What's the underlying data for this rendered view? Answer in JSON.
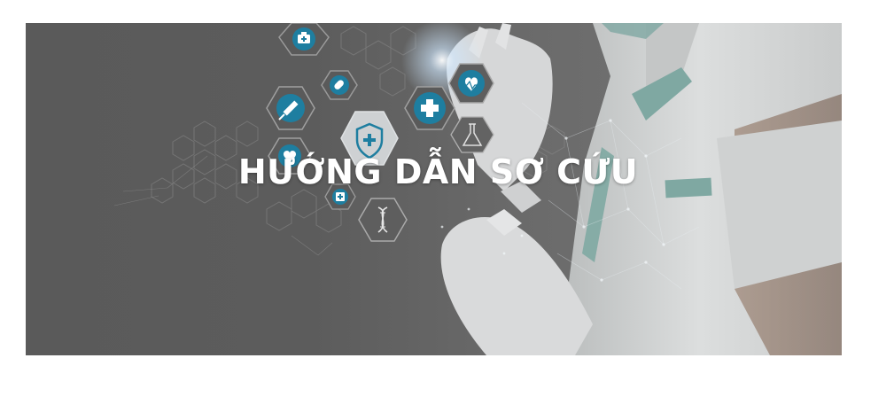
{
  "banner": {
    "title": "HƯỚNG DẪN SƠ CỨU",
    "background_color": "#5c5c5c",
    "accent_color": "#1e7ea0",
    "icons": [
      "first-aid-kit-icon",
      "pill-icon",
      "syringe-icon",
      "shield-plus-icon",
      "medical-cross-icon",
      "heart-monitor-icon",
      "flask-icon",
      "heart-rate-icon",
      "clipboard-icon",
      "dna-icon"
    ]
  }
}
